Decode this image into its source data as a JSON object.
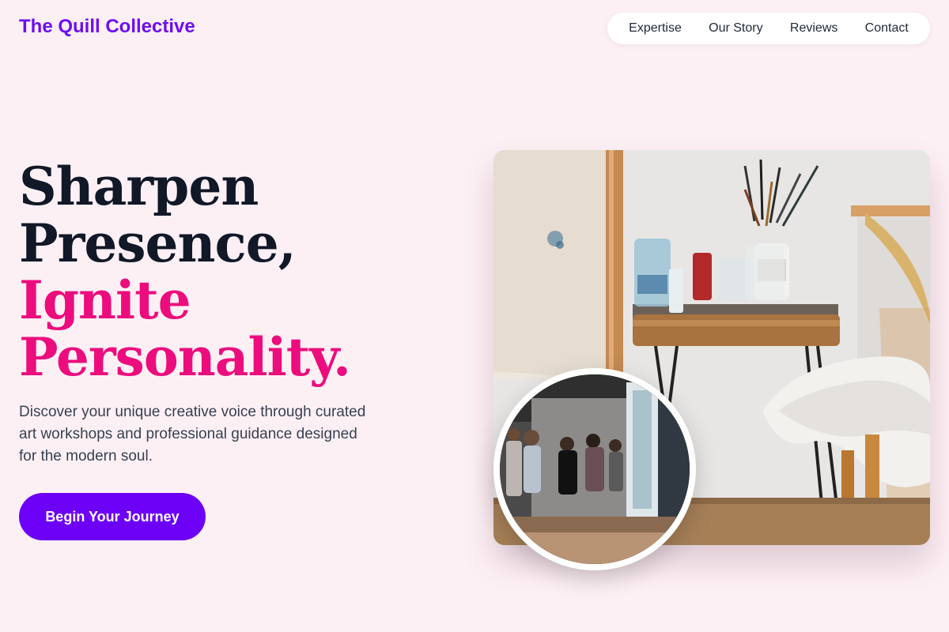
{
  "header": {
    "brand": "The Quill Collective",
    "nav": [
      "Expertise",
      "Our Story",
      "Reviews",
      "Contact"
    ]
  },
  "hero": {
    "title_line_1": "Sharpen",
    "title_line_2": "Presence,",
    "title_line_3": "Ignite",
    "title_line_4": "Personality.",
    "subtitle": "Discover your unique creative voice through curated art workshops and professional guidance designed for the modern soul.",
    "cta_label": "Begin Your Journey"
  },
  "images": {
    "main": "art-studio-photo",
    "inset": "gallery-visitors-photo"
  },
  "colors": {
    "background": "#fdf0f4",
    "brand": "#6d0df2",
    "accent": "#ec0c7d",
    "cta": "#6d00f6"
  }
}
